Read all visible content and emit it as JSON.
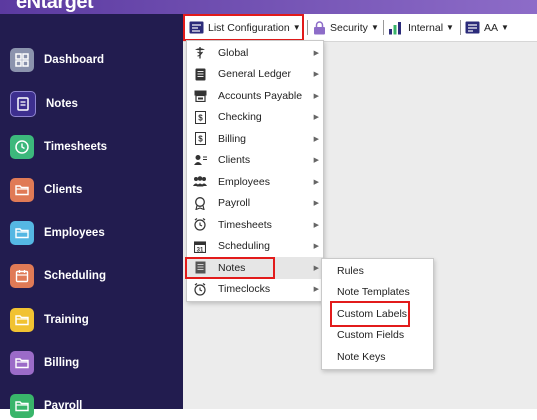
{
  "brand": "eNtarget",
  "sidebar": {
    "items": [
      {
        "label": "Dashboard",
        "color": "#8b93ad"
      },
      {
        "label": "Notes",
        "color": "#3d2f8f"
      },
      {
        "label": "Timesheets",
        "color": "#3cb87c"
      },
      {
        "label": "Clients",
        "color": "#e07a56"
      },
      {
        "label": "Employees",
        "color": "#55b7e3"
      },
      {
        "label": "Scheduling",
        "color": "#e07a56"
      },
      {
        "label": "Training",
        "color": "#f1c232"
      },
      {
        "label": "Billing",
        "color": "#9b6bc8"
      },
      {
        "label": "Payroll",
        "color": "#39b56a"
      }
    ]
  },
  "toolbar": {
    "list_config": "List Configuration",
    "security": "Security",
    "internal": "Internal",
    "aa": "AA"
  },
  "menu": {
    "items": [
      {
        "label": "Global",
        "icon": "caduceus-icon"
      },
      {
        "label": "General Ledger",
        "icon": "ledger-icon"
      },
      {
        "label": "Accounts Payable",
        "icon": "cash-register-icon"
      },
      {
        "label": "Checking",
        "icon": "dollar-doc-icon"
      },
      {
        "label": "Billing",
        "icon": "dollar-doc-icon"
      },
      {
        "label": "Clients",
        "icon": "user-list-icon"
      },
      {
        "label": "Employees",
        "icon": "users-icon"
      },
      {
        "label": "Payroll",
        "icon": "badge-icon"
      },
      {
        "label": "Timesheets",
        "icon": "alarm-clock-icon"
      },
      {
        "label": "Scheduling",
        "icon": "calendar-icon"
      },
      {
        "label": "Notes",
        "icon": "notes-icon"
      },
      {
        "label": "Timeclocks",
        "icon": "alarm-clock-icon"
      }
    ],
    "active": "Notes"
  },
  "submenu": {
    "items": [
      {
        "label": "Rules"
      },
      {
        "label": "Note Templates"
      },
      {
        "label": "Custom Labels"
      },
      {
        "label": "Custom Fields"
      },
      {
        "label": "Note Keys"
      }
    ]
  },
  "colors": {
    "sidebar_bg": "#221c4f",
    "highlight": "#e21b1b",
    "accent": "#5b3aa0"
  }
}
